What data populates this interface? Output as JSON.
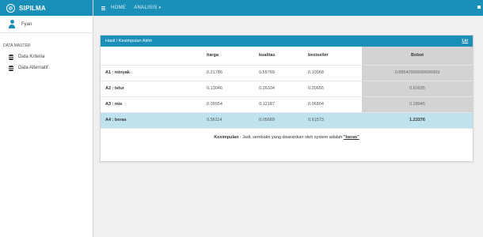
{
  "brand": {
    "name": "SIPILMA",
    "logo_icon": "circle-logo-icon"
  },
  "user": {
    "name": "Fyan",
    "icon": "user-icon"
  },
  "sidebar": {
    "section_title": "DATA MASTER",
    "items": [
      {
        "label": "Data Kriteria",
        "icon": "database-icon"
      },
      {
        "label": "Data Alternatif",
        "icon": "database-icon"
      }
    ]
  },
  "topbar": {
    "menu_icon": "hamburger-icon",
    "nav": [
      {
        "label": "HOME"
      },
      {
        "label": "ANALISIS"
      }
    ],
    "caret": "▾"
  },
  "panel": {
    "title": "Hasil / Kesimpulan Akhir",
    "action_label": "Lkt",
    "headers": [
      "",
      "harga",
      "kualitas",
      "bestseller",
      "Bobot"
    ],
    "rows": [
      {
        "name": "A1 : minyak",
        "harga": "0.21786",
        "kualitas": "0.55789",
        "bestseller": "0.10968",
        "bobot": "0.88542999999999999",
        "highlight": false
      },
      {
        "name": "A2 : telur",
        "harga": "0.13046",
        "kualitas": "0.26334",
        "bestseller": "0.20655",
        "bobot": "0.60035",
        "highlight": false
      },
      {
        "name": "A3 : mie",
        "harga": "0.09054",
        "kualitas": "0.12187",
        "bestseller": "0.06804",
        "bobot": "0.28045",
        "highlight": false
      },
      {
        "name": "A4 : beras",
        "harga": "0.56114",
        "kualitas": "0.05689",
        "bestseller": "0.61573",
        "bobot": "1.23376",
        "highlight": true
      }
    ],
    "conclusion": {
      "label": "Kesimpulan",
      "text": " : Jadi, sembako yang disarankan oleh system adalah ",
      "result": "\"beras\""
    }
  },
  "colors": {
    "primary": "#1a8fb8",
    "highlight_row": "#bfe3ee",
    "bobot_column": "#d3d3d3"
  }
}
